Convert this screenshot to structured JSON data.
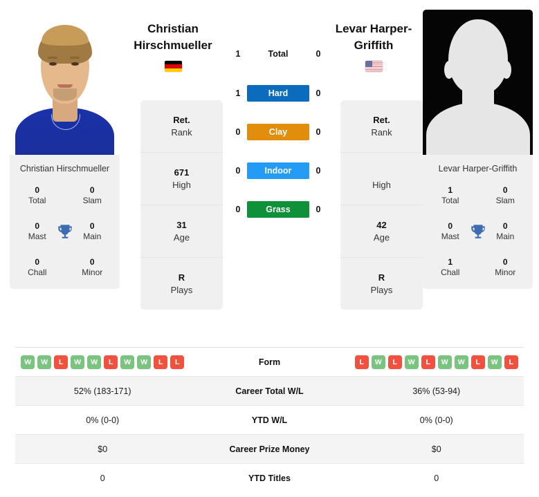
{
  "players": {
    "left": {
      "full_name": "Christian Hirschmueller",
      "name_line1": "Christian",
      "name_line2": "Hirschmueller",
      "country": "Germany",
      "flag_icon": "flag-germany-icon",
      "photo_alt": "Christian Hirschmueller headshot",
      "titles": {
        "total": "0",
        "total_label": "Total",
        "slam": "0",
        "slam_label": "Slam",
        "mast": "0",
        "mast_label": "Mast",
        "main": "0",
        "main_label": "Main",
        "chall": "0",
        "chall_label": "Chall",
        "minor": "0",
        "minor_label": "Minor"
      },
      "profile": {
        "rank": "Ret.",
        "rank_label": "Rank",
        "high": "671",
        "high_label": "High",
        "age": "31",
        "age_label": "Age",
        "plays": "R",
        "plays_label": "Plays"
      },
      "form": [
        "W",
        "W",
        "L",
        "W",
        "W",
        "L",
        "W",
        "W",
        "L",
        "L"
      ],
      "career_wl": "52% (183-171)",
      "ytd_wl": "0% (0-0)",
      "prize_money": "$0",
      "ytd_titles": "0"
    },
    "right": {
      "full_name": "Levar Harper-Griffith",
      "name_line1": "Levar Harper-",
      "name_line2": "Griffith",
      "country": "United States",
      "flag_icon": "flag-usa-icon",
      "photo_alt": "Levar Harper-Griffith placeholder avatar",
      "titles": {
        "total": "1",
        "total_label": "Total",
        "slam": "0",
        "slam_label": "Slam",
        "mast": "0",
        "mast_label": "Mast",
        "main": "0",
        "main_label": "Main",
        "chall": "1",
        "chall_label": "Chall",
        "minor": "0",
        "minor_label": "Minor"
      },
      "profile": {
        "rank": "Ret.",
        "rank_label": "Rank",
        "high": "",
        "high_label": "High",
        "age": "42",
        "age_label": "Age",
        "plays": "R",
        "plays_label": "Plays"
      },
      "form": [
        "L",
        "W",
        "L",
        "W",
        "L",
        "W",
        "W",
        "L",
        "W",
        "L"
      ],
      "career_wl": "36% (53-94)",
      "ytd_wl": "0% (0-0)",
      "prize_money": "$0",
      "ytd_titles": "0"
    }
  },
  "surfaces": [
    {
      "key": "total",
      "label": "Total",
      "left": "1",
      "right": "0",
      "color": "transparent",
      "text_color": "#111111"
    },
    {
      "key": "hard",
      "label": "Hard",
      "left": "1",
      "right": "0",
      "color": "#0b6cbd",
      "text_color": "#ffffff"
    },
    {
      "key": "clay",
      "label": "Clay",
      "left": "0",
      "right": "0",
      "color": "#e08e0b",
      "text_color": "#ffffff"
    },
    {
      "key": "indoor",
      "label": "Indoor",
      "left": "0",
      "right": "0",
      "color": "#249bf5",
      "text_color": "#ffffff"
    },
    {
      "key": "grass",
      "label": "Grass",
      "left": "0",
      "right": "0",
      "color": "#0e9139",
      "text_color": "#ffffff"
    }
  ],
  "table": {
    "rows": [
      {
        "label": "Form",
        "type": "form"
      },
      {
        "label": "Career Total W/L",
        "type": "text",
        "left": "52% (183-171)",
        "right": "36% (53-94)"
      },
      {
        "label": "YTD W/L",
        "type": "text",
        "left": "0% (0-0)",
        "right": "0% (0-0)"
      },
      {
        "label": "Career Prize Money",
        "type": "text",
        "left": "$0",
        "right": "$0"
      },
      {
        "label": "YTD Titles",
        "type": "text",
        "left": "0",
        "right": "0"
      }
    ]
  },
  "colors": {
    "win": "#7ac47f",
    "loss": "#f0523f",
    "panel": "#f0f0f0",
    "row_alt": "#f4f4f4"
  }
}
